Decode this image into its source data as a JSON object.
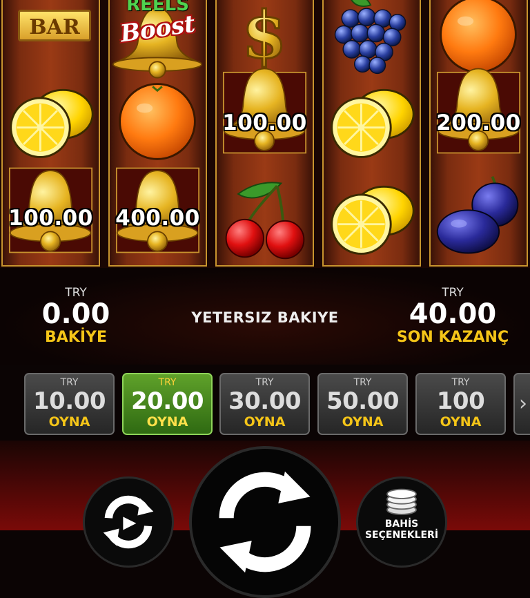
{
  "reels": {
    "reel1": {
      "row0": "BAR",
      "row1": "lemon",
      "row2_value": "100.00"
    },
    "reel2": {
      "row0_line1": "REELS",
      "row0_line2": "Boost",
      "row1": "orange",
      "row2_value": "400.00"
    },
    "reel3": {
      "row0": "dollar",
      "row1_value": "100.00",
      "row2": "cherry"
    },
    "reel4": {
      "row0": "grapes",
      "row1": "lemon",
      "row2": "lemon"
    },
    "reel5": {
      "row0": "orange",
      "row1_value": "200.00",
      "row2": "plum"
    }
  },
  "balance": {
    "currency": "TRY",
    "value": "0.00",
    "label": "BAKİYE"
  },
  "status": "YETERSIZ BAKIYE",
  "last_win": {
    "currency": "TRY",
    "value": "40.00",
    "label": "SON KAZANÇ"
  },
  "bets": [
    {
      "currency": "TRY",
      "amount": "10.00",
      "label": "OYNA"
    },
    {
      "currency": "TRY",
      "amount": "20.00",
      "label": "OYNA",
      "selected": true
    },
    {
      "currency": "TRY",
      "amount": "30.00",
      "label": "OYNA"
    },
    {
      "currency": "TRY",
      "amount": "50.00",
      "label": "OYNA"
    },
    {
      "currency": "TRY",
      "amount": "100",
      "label": "OYNA"
    }
  ],
  "bets_more_icon": "chevron-right-icon",
  "controls": {
    "autoplay_icon": "autoplay-icon",
    "spin_icon": "spin-icon",
    "bet_options_line1": "BAHİS",
    "bet_options_line2": "SEÇENEKLERİ"
  },
  "colors": {
    "accent_gold": "#f5c518",
    "selected_bet": "#4f8f22",
    "reel_wood": "#9a3a15"
  }
}
